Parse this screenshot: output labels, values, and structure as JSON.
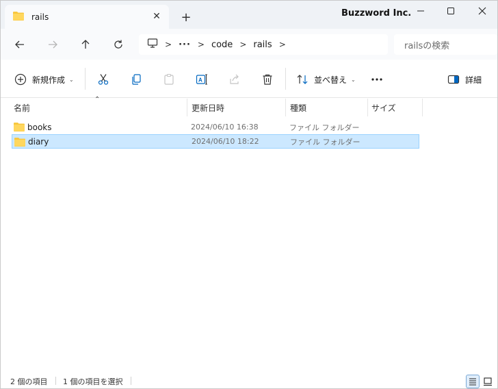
{
  "window": {
    "tab_title": "rails",
    "brand": "Buzzword Inc.",
    "controls": [
      "minimize-icon",
      "maximize-icon",
      "close-icon"
    ]
  },
  "nav": {
    "breadcrumb": [
      "code",
      "rails"
    ],
    "search_placeholder": "railsの検索"
  },
  "toolbar": {
    "new_label": "新規作成",
    "sort_label": "並べ替え",
    "details_label": "詳細"
  },
  "columns": {
    "name": "名前",
    "date": "更新日時",
    "type": "種類",
    "size": "サイズ"
  },
  "files": [
    {
      "name": "books",
      "date": "2024/06/10 16:38",
      "type": "ファイル フォルダー",
      "selected": false
    },
    {
      "name": "diary",
      "date": "2024/06/10 18:22",
      "type": "ファイル フォルダー",
      "selected": true
    }
  ],
  "status": {
    "item_count": "2 個の項目",
    "selected_count": "1 個の項目を選択"
  },
  "colors": {
    "folder": "#f8c73f",
    "selection_bg": "#cce8ff",
    "selection_border": "#99d1ff",
    "accent": "#0067c0"
  }
}
